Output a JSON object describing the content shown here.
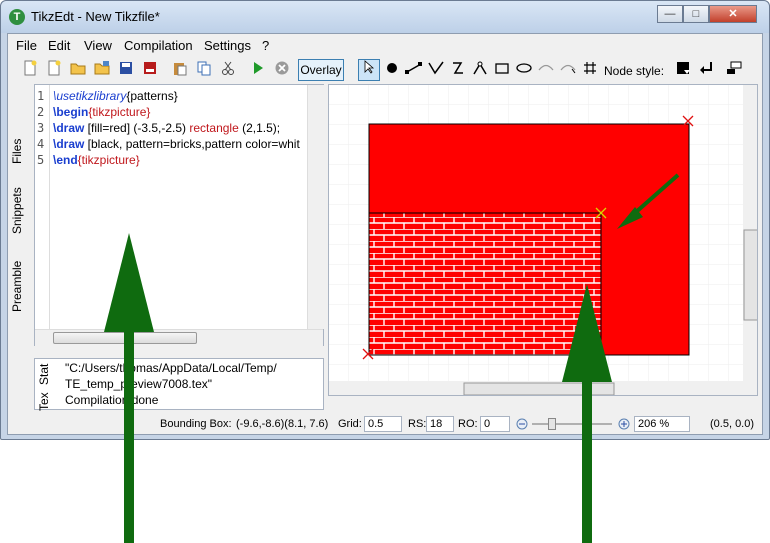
{
  "window": {
    "title": "TikzEdt - New Tikzfile*",
    "icon_letter": "T",
    "minimize": "—",
    "maximize": "□",
    "close": "✕"
  },
  "menu": [
    "File",
    "Edit",
    "View",
    "Compilation",
    "Settings",
    "?"
  ],
  "toolbar": {
    "overlay": "Overlay",
    "node_style_label": "Node style:"
  },
  "side_tabs": [
    "Files",
    "Snippets",
    "Preamble"
  ],
  "editor": {
    "line_numbers": [
      "1",
      "2",
      "3",
      "4",
      "5"
    ],
    "lines": [
      {
        "cmd": "\\usetikzlibrary",
        "arg": "{patterns}"
      },
      {
        "cmd": "\\begin",
        "env": "{tikzpicture}"
      },
      {
        "cmd": "\\draw",
        "rest1": " [fill=red] (-3.5,-2.5) ",
        "kw2": "rectangle",
        "rest2": " (2,1.5);"
      },
      {
        "cmd": "\\draw",
        "rest1": " [black, pattern=bricks,pattern color=whit"
      },
      {
        "cmd": "\\end",
        "env": "{tikzpicture}"
      }
    ]
  },
  "log": {
    "tabs": [
      "Stat",
      "Tex"
    ],
    "lines": [
      "\"C:/Users/thomas/AppData/Local/Temp/",
      "TE_temp_preview7008.tex\"",
      "Compilation done"
    ]
  },
  "status": {
    "bbox_label": "Bounding Box:",
    "bbox_value": "(-9.6,-8.6)(8.1, 7.6)",
    "grid_label": "Grid:",
    "grid_value": "0.5",
    "rs_label": "RS:",
    "rs_value": "18",
    "ro_label": "RO:",
    "ro_value": "0",
    "zoom_value": "206 %",
    "coords": "(0.5, 0.0)"
  },
  "colors": {
    "rect_fill": "#ff0000",
    "arrow": "#0f6b0f",
    "handle_x": "#e01010",
    "handle_sel": "#d8d800"
  },
  "icons": [
    "new-file-icon",
    "new-from-template-icon",
    "open-icon",
    "open-recent-icon",
    "save-icon",
    "export-pdf-icon",
    "paste-icon",
    "copy-icon",
    "cut-icon",
    "compile-icon",
    "abort-icon",
    "select-tool-icon",
    "node-tool-icon",
    "edge-tool-icon",
    "path-tool-icon",
    "bezier-tool-icon",
    "smooth-curve-tool-icon",
    "rectangle-tool-icon",
    "ellipse-tool-icon",
    "arc-tool-icon",
    "arc-edit-tool-icon",
    "grid-tool-icon",
    "node-style-icon",
    "newline-icon",
    "style-tool-icon"
  ]
}
